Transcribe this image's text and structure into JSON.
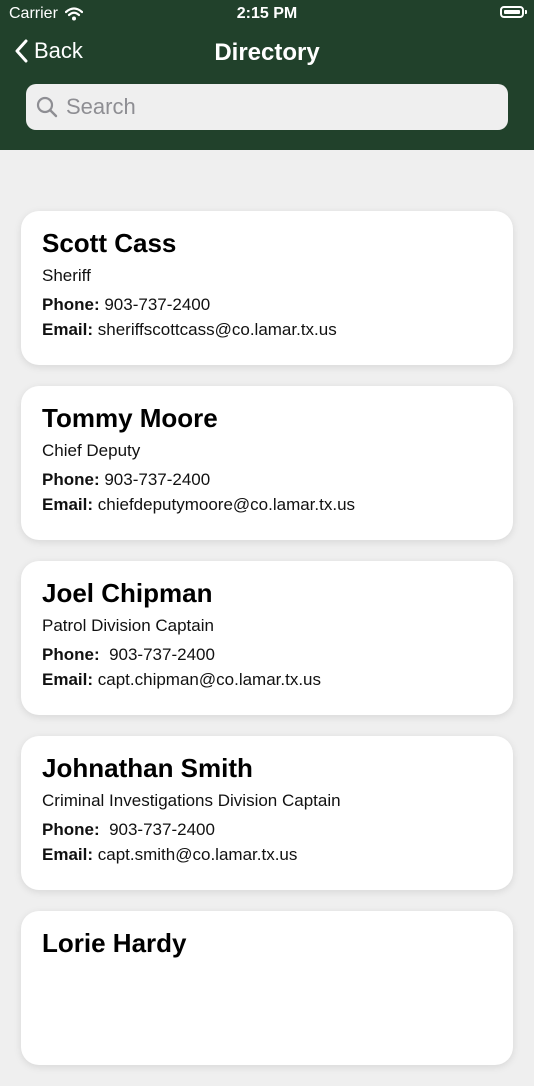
{
  "status_bar": {
    "carrier": "Carrier",
    "time": "2:15 PM"
  },
  "nav": {
    "back_label": "Back",
    "title": "Directory"
  },
  "search": {
    "placeholder": "Search",
    "value": ""
  },
  "labels": {
    "phone": "Phone:",
    "email": "Email:"
  },
  "contacts": [
    {
      "name": "Scott Cass",
      "title": "Sheriff",
      "phone": "903-737-2400",
      "email": "sheriffscottcass@co.lamar.tx.us"
    },
    {
      "name": "Tommy Moore",
      "title": "Chief Deputy",
      "phone": "903-737-2400",
      "email": "chiefdeputymoore@co.lamar.tx.us"
    },
    {
      "name": "Joel Chipman",
      "title": "Patrol Division Captain",
      "phone": " 903-737-2400",
      "email": "capt.chipman@co.lamar.tx.us"
    },
    {
      "name": "Johnathan Smith",
      "title": "Criminal Investigations Division Captain",
      "phone": " 903-737-2400",
      "email": "capt.smith@co.lamar.tx.us"
    },
    {
      "name": "Lorie Hardy",
      "title": "",
      "phone": "",
      "email": ""
    }
  ],
  "colors": {
    "nav_bg": "#21412b",
    "page_bg": "#efefef",
    "card_bg": "#ffffff"
  },
  "icons": {
    "wifi": "wifi-icon",
    "battery": "battery-icon",
    "back": "chevron-left-icon",
    "search": "search-icon"
  }
}
